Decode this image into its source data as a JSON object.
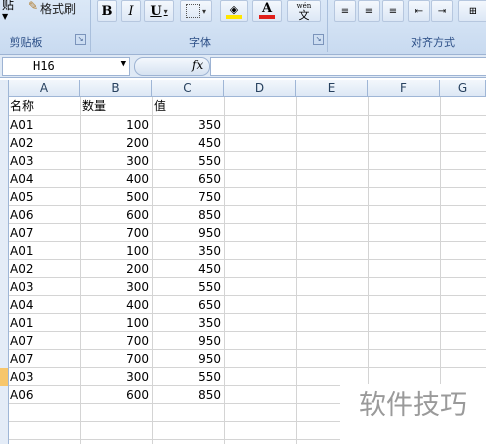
{
  "ribbon": {
    "clipboard_partial_label": "贴",
    "format_painter_label": "格式刷",
    "groups": {
      "clipboard": "剪贴板",
      "font": "字体",
      "alignment": "对齐方式"
    },
    "bold": "B",
    "italic": "I",
    "underline": "U",
    "phonetic_top": "wén",
    "phonetic_bottom": "文",
    "font_color_letter": "A"
  },
  "formula_bar": {
    "name_box": "H16",
    "fx": "fx",
    "formula": ""
  },
  "columns": [
    "A",
    "B",
    "C",
    "D",
    "E",
    "F",
    "G"
  ],
  "header_row": {
    "name": "名称",
    "quantity": "数量",
    "value": "值"
  },
  "rows": [
    {
      "name": "A01",
      "qty": "100",
      "val": "350"
    },
    {
      "name": "A02",
      "qty": "200",
      "val": "450"
    },
    {
      "name": "A03",
      "qty": "300",
      "val": "550"
    },
    {
      "name": "A04",
      "qty": "400",
      "val": "650"
    },
    {
      "name": "A05",
      "qty": "500",
      "val": "750"
    },
    {
      "name": "A06",
      "qty": "600",
      "val": "850"
    },
    {
      "name": "A07",
      "qty": "700",
      "val": "950"
    },
    {
      "name": "A01",
      "qty": "100",
      "val": "350"
    },
    {
      "name": "A02",
      "qty": "200",
      "val": "450"
    },
    {
      "name": "A03",
      "qty": "300",
      "val": "550"
    },
    {
      "name": "A04",
      "qty": "400",
      "val": "650"
    },
    {
      "name": "A01",
      "qty": "100",
      "val": "350"
    },
    {
      "name": "A07",
      "qty": "700",
      "val": "950"
    },
    {
      "name": "A07",
      "qty": "700",
      "val": "950"
    },
    {
      "name": "A03",
      "qty": "300",
      "val": "550"
    },
    {
      "name": "A06",
      "qty": "600",
      "val": "850"
    }
  ],
  "selected_row_index": 15,
  "watermark": "软件技巧",
  "colors": {
    "ribbon_bg": "#c8daf0",
    "group_label": "#2b4e86",
    "highlight_row": "#f7c66b",
    "font_color_bar": "#e0201b",
    "fill_color_bar": "#ffe600"
  }
}
